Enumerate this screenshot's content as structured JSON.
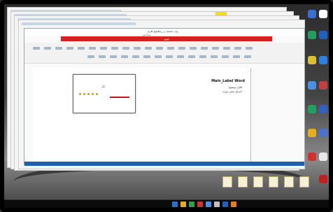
{
  "main_window": {
    "doc_title": "وب نخسه ی رتطیمغ ظرم",
    "sub_title": "شناحتی",
    "red_bar_text": "چون",
    "heading": "Main_Label Word",
    "bullets": [
      "فایل توضیح",
      "اجرای متنی ویژه"
    ],
    "embedded_text": "کار"
  },
  "colors": {
    "ribbon_accent": "#d62020",
    "status_bar": "#1f5fb0",
    "highlight": "#f4e000"
  },
  "icons": [
    "desktop-icon",
    "folder-icon",
    "settings-icon",
    "search-icon",
    "browser-icon"
  ]
}
